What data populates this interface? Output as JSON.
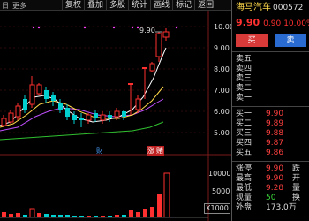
{
  "toolbar": {
    "tabs": [
      "日",
      "更多"
    ],
    "buttons": [
      "复权",
      "叠加",
      "多股",
      "统计",
      "画线",
      "标记",
      "返回"
    ]
  },
  "chart": {
    "price_labels": [
      "10.00",
      "9.00",
      "8.00",
      "7.00",
      "6.00",
      "5.00"
    ],
    "vol_labels": [
      "10000",
      "5000"
    ],
    "vol_unit": "X1000",
    "peak_label": "9.90",
    "markers": [
      "财",
      "涨",
      "赌"
    ],
    "colors": {
      "up": "#ff3030",
      "down": "#00d0d0",
      "ma5": "#ffffff",
      "ma10": "#ffd84a",
      "ma20": "#c050ff",
      "ma60": "#30c030"
    }
  },
  "panel": {
    "stock_name": "海马汽车",
    "stock_code": "000572",
    "price": "9.90",
    "change": "0.90",
    "pct": "10.00%",
    "buy_label": "买",
    "sell_label": "卖",
    "asks": [
      {
        "label": "卖五",
        "price": "",
        "vol": ""
      },
      {
        "label": "卖四",
        "price": "",
        "vol": ""
      },
      {
        "label": "卖三",
        "price": "",
        "vol": ""
      },
      {
        "label": "卖二",
        "price": "",
        "vol": ""
      },
      {
        "label": "卖一",
        "price": "",
        "vol": ""
      }
    ],
    "bids": [
      {
        "label": "买一",
        "price": "9.90",
        "vol": ""
      },
      {
        "label": "买二",
        "price": "9.89",
        "vol": ""
      },
      {
        "label": "买三",
        "price": "9.88",
        "vol": ""
      },
      {
        "label": "买四",
        "price": "9.87",
        "vol": ""
      },
      {
        "label": "买五",
        "price": "9.86",
        "vol": ""
      }
    ],
    "stats": [
      {
        "label": "涨停",
        "value": "9.90",
        "extra": "跌",
        "color": "red"
      },
      {
        "label": "最高",
        "value": "9.90",
        "extra": "开",
        "color": "red"
      },
      {
        "label": "最低",
        "value": "9.28",
        "extra": "量",
        "color": "red"
      },
      {
        "label": "现量",
        "value": "50",
        "extra": "换",
        "color": "green"
      },
      {
        "label": "外盘",
        "value": "173.0万",
        "extra": "",
        "color": "white"
      }
    ]
  }
}
